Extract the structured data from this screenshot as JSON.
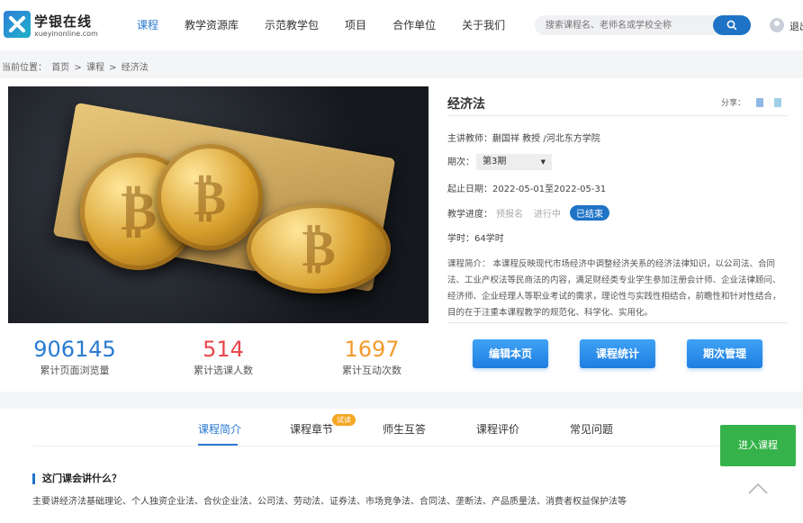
{
  "header": {
    "logo_title": "学银在线",
    "logo_sub": "xueyinonline.com",
    "nav": [
      "课程",
      "教学资源库",
      "示范教学包",
      "项目",
      "合作单位",
      "关于我们"
    ],
    "search_placeholder": "搜索课程名、老师名或学校全称",
    "logout": "退出"
  },
  "breadcrumb": {
    "prefix": "当前位置：",
    "items": [
      "首页",
      ">",
      "课程",
      ">",
      "经济法"
    ]
  },
  "course": {
    "title": "经济法",
    "share_label": "分享：",
    "teacher": "主讲教师：蒯国祥 教授 /河北东方学院",
    "period_label": "期次：",
    "period_value": "第3期",
    "dates": "起止日期：2022-05-01至2022-05-31",
    "progress_label": "教学进度：",
    "progress_states": [
      "预报名",
      "进行中",
      "已结束"
    ],
    "hours": "学时：64学时",
    "intro": "课程简介：  本课程反映现代市场经济中调整经济关系的经济法律知识，以公司法、合同法、工业产权法等民商法的内容，满足财经类专业学生参加注册会计师、企业法律顾问、经济师、企业经理人等职业考试的需求，理论性与实践性相结合，前瞻性和针对性结合，目的在于注重本课程教学的规范化、科学化、实用化。"
  },
  "stats": [
    {
      "value": "906145",
      "label": "累计页面浏览量",
      "color": "#2a7ad1"
    },
    {
      "value": "514",
      "label": "累计选课人数",
      "color": "#e8474a"
    },
    {
      "value": "1697",
      "label": "累计互动次数",
      "color": "#f39a2c"
    }
  ],
  "buttons": [
    "编辑本页",
    "课程统计",
    "期次管理"
  ],
  "tabs": {
    "items": [
      "课程简介",
      "课程章节",
      "师生互答",
      "课程评价",
      "常见问题"
    ],
    "badge": "试读"
  },
  "section": {
    "title": "这门课会讲什么？",
    "text": "主要讲经济法基础理论、个人独资企业法、合伙企业法、公司法、劳动法、证券法、市场竞争法、合同法、垄断法、产品质量法、消费者权益保护法等"
  },
  "enter_button": "进入课程"
}
